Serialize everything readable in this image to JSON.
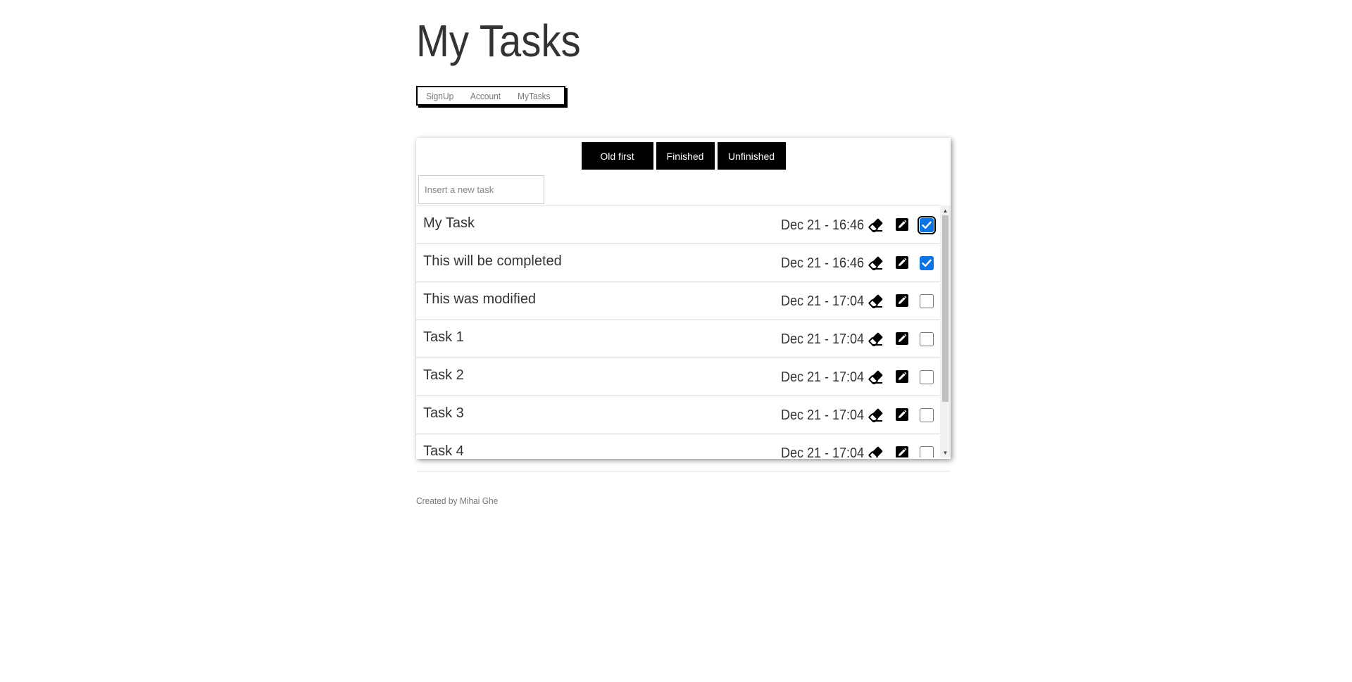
{
  "page": {
    "title": "My Tasks"
  },
  "nav": {
    "items": [
      {
        "label": "SignUp"
      },
      {
        "label": "Account"
      },
      {
        "label": "MyTasks"
      }
    ]
  },
  "filters": {
    "old_first": "Old first",
    "finished": "Finished",
    "unfinished": "Unfinished"
  },
  "new_task": {
    "placeholder": "Insert a new task",
    "value": ""
  },
  "tasks": [
    {
      "name": "My Task",
      "date": "Dec 21 - 16:46",
      "done": true,
      "focused": true
    },
    {
      "name": "This will be completed",
      "date": "Dec 21 - 16:46",
      "done": true,
      "focused": false
    },
    {
      "name": "This was modified",
      "date": "Dec 21 - 17:04",
      "done": false,
      "focused": false
    },
    {
      "name": "Task 1",
      "date": "Dec 21 - 17:04",
      "done": false,
      "focused": false
    },
    {
      "name": "Task 2",
      "date": "Dec 21 - 17:04",
      "done": false,
      "focused": false
    },
    {
      "name": "Task 3",
      "date": "Dec 21 - 17:04",
      "done": false,
      "focused": false
    },
    {
      "name": "Task 4",
      "date": "Dec 21 - 17:04",
      "done": false,
      "focused": false
    }
  ],
  "icons": {
    "delete": "eraser-icon",
    "edit": "edit-icon",
    "check": "checkmark-icon"
  },
  "colors": {
    "accent": "#0b74e5",
    "button_bg": "#000000",
    "text": "#333333",
    "muted": "#777777"
  },
  "footer": {
    "text": "Created by Mihai Ghe"
  }
}
